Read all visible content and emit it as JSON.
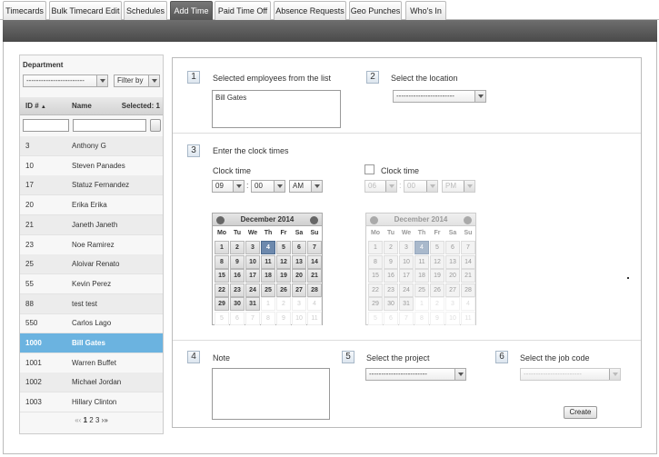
{
  "tabs": [
    "Timecards",
    "Bulk Timecard Edit",
    "Schedules",
    "Add Time",
    "Paid Time Off",
    "Absence Requests",
    "Geo Punches",
    "Who's In"
  ],
  "sidebar": {
    "department_label": "Department",
    "department_value": "------------------------",
    "filter_label": "Filter by",
    "col_id": "ID #",
    "col_name": "Name",
    "selected_label": "Selected: 1",
    "rows": [
      {
        "id": "3",
        "name": "Anthony G"
      },
      {
        "id": "10",
        "name": "Steven Panades"
      },
      {
        "id": "17",
        "name": "Statuz Fernandez"
      },
      {
        "id": "20",
        "name": "Erika Erika"
      },
      {
        "id": "21",
        "name": "Janeth Janeth"
      },
      {
        "id": "23",
        "name": "Noe Ramirez"
      },
      {
        "id": "25",
        "name": "Aloivar Renato"
      },
      {
        "id": "55",
        "name": "Kevin Perez"
      },
      {
        "id": "88",
        "name": "test test"
      },
      {
        "id": "550",
        "name": "Carlos Lago"
      },
      {
        "id": "1000",
        "name": "Bill Gates"
      },
      {
        "id": "1001",
        "name": "Warren Buffet"
      },
      {
        "id": "1002",
        "name": "Michael Jordan"
      },
      {
        "id": "1003",
        "name": "Hillary Clinton"
      }
    ],
    "selected_row": 10,
    "pager": {
      "first": "«",
      "prev": "‹",
      "pages": [
        "1",
        "2",
        "3"
      ],
      "next": "›",
      "last": "»"
    }
  },
  "form": {
    "s1": {
      "num": "1",
      "title": "Selected employees from the list",
      "value": "Bill Gates"
    },
    "s2": {
      "num": "2",
      "title": "Select the location",
      "value": "------------------------"
    },
    "s3": {
      "num": "3",
      "title": "Enter the clock times"
    },
    "clock1": {
      "label": "Clock time",
      "hour": "09",
      "minute": "00",
      "ampm": "AM"
    },
    "clock2": {
      "label": "Clock time",
      "hour": "06",
      "minute": "00",
      "ampm": "PM"
    },
    "calendar": {
      "month": "December 2014",
      "dow": [
        "Mo",
        "Tu",
        "We",
        "Th",
        "Fr",
        "Sa",
        "Su"
      ],
      "weeks": [
        [
          "1",
          "2",
          "3",
          "4",
          "5",
          "6",
          "7"
        ],
        [
          "8",
          "9",
          "10",
          "11",
          "12",
          "13",
          "14"
        ],
        [
          "15",
          "16",
          "17",
          "18",
          "19",
          "20",
          "21"
        ],
        [
          "22",
          "23",
          "24",
          "25",
          "26",
          "27",
          "28"
        ],
        [
          "29",
          "30",
          "31",
          "1",
          "2",
          "3",
          "4"
        ],
        [
          "5",
          "6",
          "7",
          "8",
          "9",
          "10",
          "11"
        ]
      ],
      "today": "4"
    },
    "s4": {
      "num": "4",
      "title": "Note"
    },
    "s5": {
      "num": "5",
      "title": "Select the project",
      "value": "------------------------"
    },
    "s6": {
      "num": "6",
      "title": "Select the job code",
      "value": "------------------------"
    },
    "create_label": "Create"
  }
}
